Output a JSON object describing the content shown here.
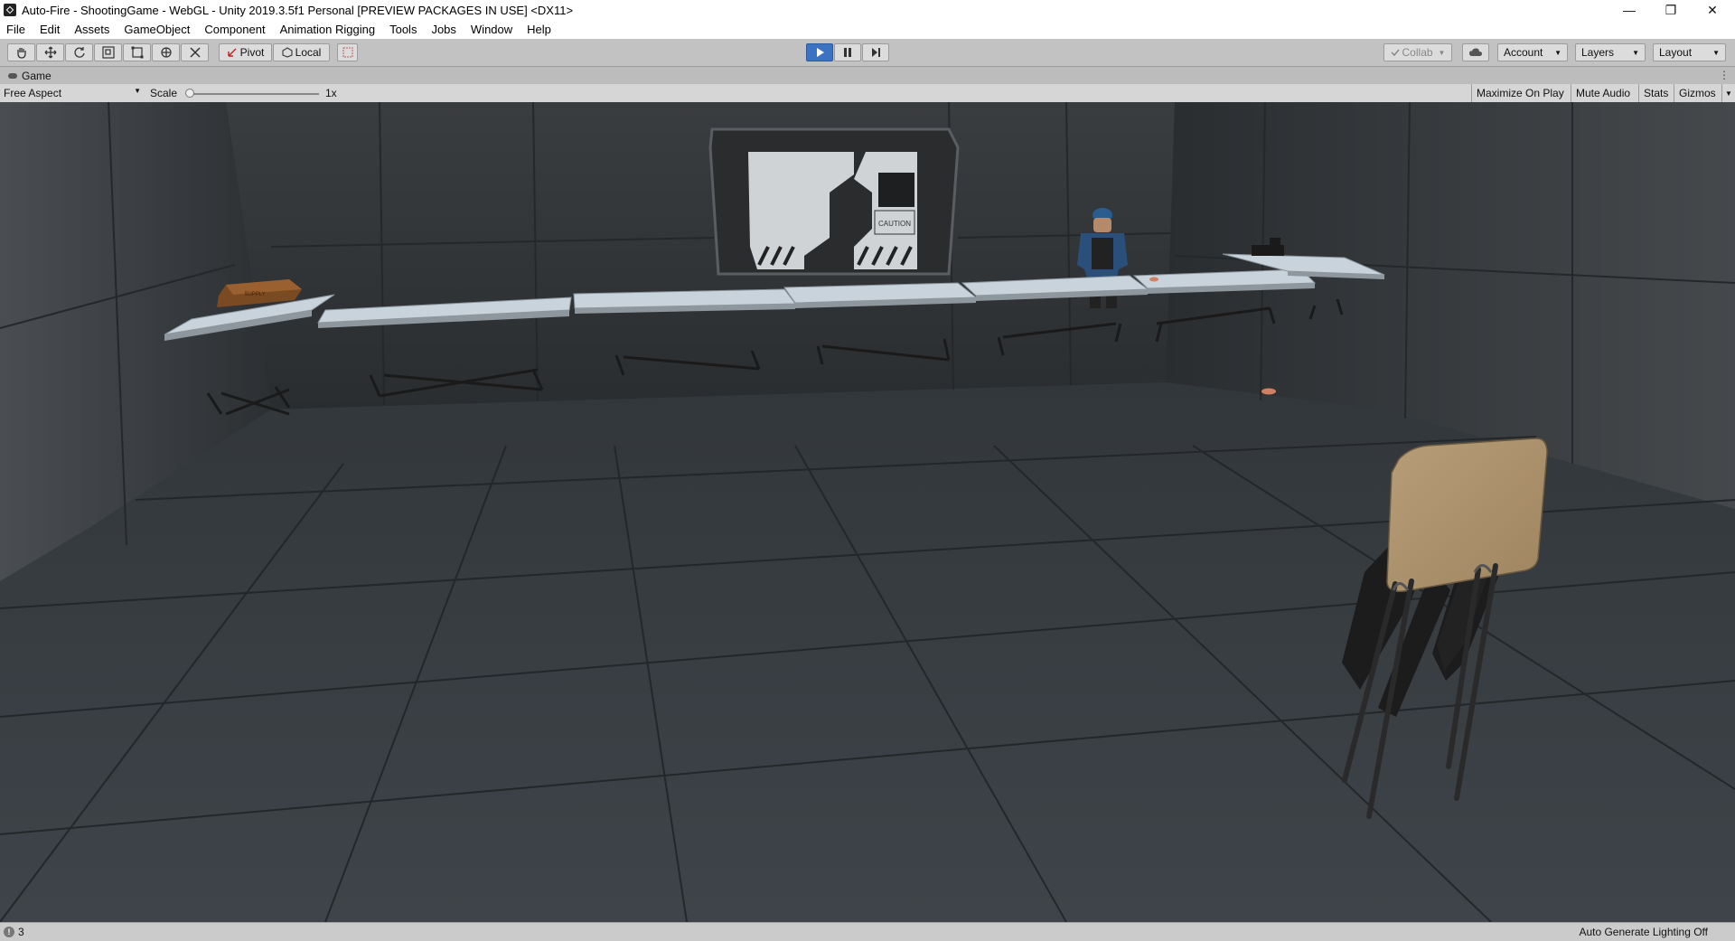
{
  "window": {
    "title": "Auto-Fire - ShootingGame - WebGL - Unity 2019.3.5f1 Personal [PREVIEW PACKAGES IN USE] <DX11>",
    "minimize": "—",
    "restore": "❐",
    "close": "✕"
  },
  "menu": [
    "File",
    "Edit",
    "Assets",
    "GameObject",
    "Component",
    "Animation Rigging",
    "Tools",
    "Jobs",
    "Window",
    "Help"
  ],
  "toolbar": {
    "tools": [
      "hand-tool",
      "move-tool",
      "rotate-tool",
      "scale-tool",
      "rect-tool",
      "transform-tool",
      "custom-tool"
    ],
    "pivot_label": "Pivot",
    "local_label": "Local",
    "play_active": true,
    "collab_label": "Collab",
    "account_label": "Account",
    "layers_label": "Layers",
    "layout_label": "Layout"
  },
  "game_panel": {
    "tab_label": "Game",
    "aspect": "Free Aspect",
    "scale_label": "Scale",
    "scale_value": "1x",
    "scale_level": 0,
    "maximize_on_play": "Maximize On Play",
    "mute_audio": "Mute Audio",
    "stats": "Stats",
    "gizmos": "Gizmos"
  },
  "scene": {
    "box_label": "SUPPLY",
    "door_sign": "CAUTION"
  },
  "status": {
    "message_count": "3",
    "lighting": "Auto Generate Lighting Off"
  },
  "colors": {
    "play_accent": "#3b73c2",
    "editor_bg": "#c2c2c2",
    "scene_floor": "#3a3f44",
    "table_top": "#c9d3dc"
  }
}
